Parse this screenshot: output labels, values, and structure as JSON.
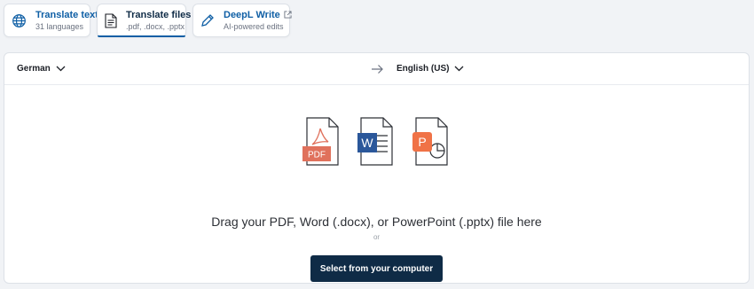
{
  "tabs": [
    {
      "title": "Translate text",
      "subtitle": "31 languages",
      "icon": "globe-icon"
    },
    {
      "title": "Translate files",
      "subtitle": ".pdf, .docx, .pptx",
      "icon": "document-icon",
      "active": true
    },
    {
      "title": "DeepL Write",
      "subtitle": "AI-powered edits",
      "icon": "pen-icon",
      "external_icon": "external-link-icon"
    }
  ],
  "languages": {
    "source": "German",
    "target": "English (US)",
    "swap_icon": "arrow-right-icon"
  },
  "dropzone": {
    "file_icons": [
      {
        "name": "pdf-file-icon",
        "badge": "PDF",
        "color": "#e0715c"
      },
      {
        "name": "word-file-icon",
        "badge": "W",
        "color": "#2b579a"
      },
      {
        "name": "powerpoint-file-icon",
        "badge": "P",
        "color": "#f07246"
      }
    ],
    "instruction": "Drag your PDF, Word (.docx), or PowerPoint (.pptx) file here",
    "or_text": "or",
    "button_label": "Select from your computer"
  },
  "colors": {
    "primary_dark": "#0f2b46",
    "accent_blue": "#0f5fa5",
    "background": "#f1f3f6"
  }
}
